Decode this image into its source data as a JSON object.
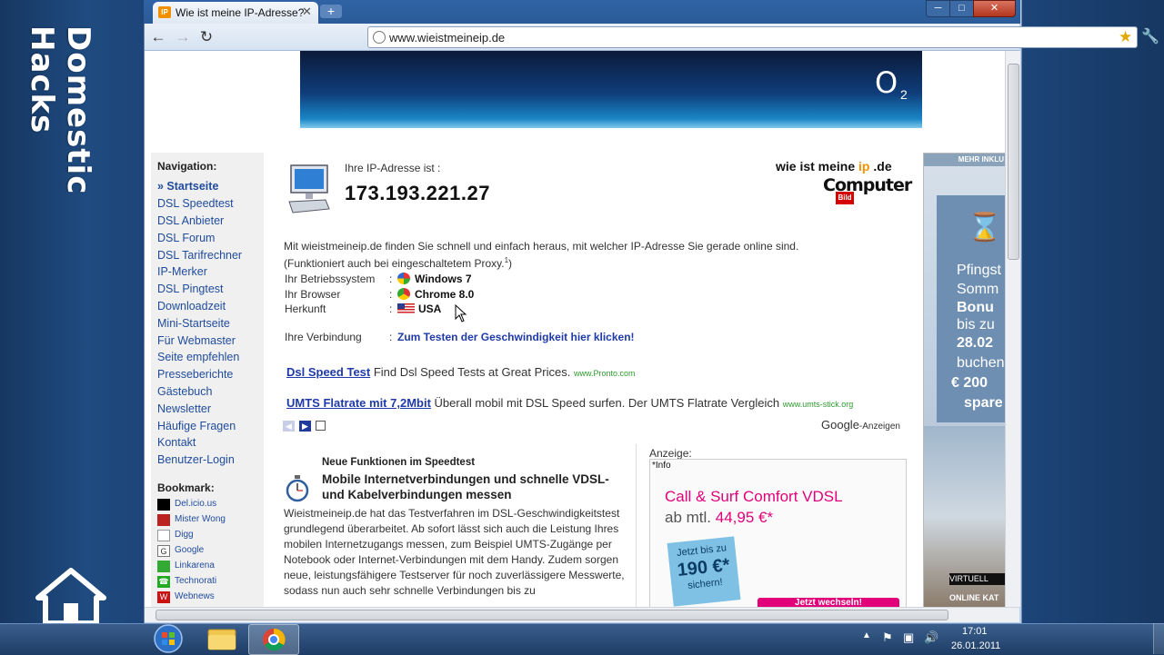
{
  "branding": {
    "channel_name": "Domestic Hacks"
  },
  "browser": {
    "tab_title": "Wie ist meine IP-Adresse?",
    "tab_favicon": "IP",
    "url": "www.wieistmeineip.de",
    "window_buttons": {
      "minimize": "─",
      "maximize": "□",
      "close": "✕"
    }
  },
  "banner": {
    "brand": "O",
    "brand_sub": "2"
  },
  "nav": {
    "title": "Navigation:",
    "items": [
      "» Startseite",
      "DSL Speedtest",
      "DSL Anbieter",
      "DSL Forum",
      "DSL Tarifrechner",
      "IP-Merker",
      "DSL Pingtest",
      "Downloadzeit",
      "Mini-Startseite",
      "Für Webmaster",
      "Seite empfehlen",
      "Presseberichte",
      "Gästebuch",
      "Newsletter",
      "Häufige Fragen",
      "Kontakt",
      "Benutzer-Login"
    ]
  },
  "bookmarks": {
    "title": "Bookmark:",
    "items": [
      "Del.icio.us",
      "Mister Wong",
      "Digg",
      "Google",
      "Linkarena",
      "Technorati",
      "Webnews"
    ]
  },
  "ip": {
    "label": "Ihre IP-Adresse ist :",
    "value": "173.193.221.27"
  },
  "logo": {
    "part1": "wie ist meine ",
    "part2": "ip",
    "part3": " .de",
    "computer": "Computer",
    "bild": "Bild"
  },
  "intro": {
    "line1": "Mit wieistmeineip.de finden Sie schnell und einfach heraus, mit welcher IP-Adresse Sie gerade online sind.",
    "line2": "(Funktioniert auch bei eingeschaltetem Proxy.",
    "sup": "1",
    "line2_end": ")"
  },
  "info": {
    "os_label": "Ihr Betriebssystem",
    "os_value": "Windows 7",
    "browser_label": "Ihr Browser",
    "browser_value": "Chrome 8.0",
    "origin_label": "Herkunft",
    "origin_value": "USA",
    "connection_label": "Ihre Verbindung",
    "connection_link": "Zum Testen der Geschwindigkeit hier klicken!",
    "colon": ":"
  },
  "ads": [
    {
      "title": "Dsl Speed Test",
      "text": " Find Dsl Speed Tests at Great Prices. ",
      "url": "www.Pronto.com"
    },
    {
      "title": "UMTS Flatrate mit 7,2Mbit",
      "text": " Überall mobil mit DSL Speed surfen. Der UMTS Flatrate Vergleich ",
      "url": "www.umts-stick.org"
    }
  ],
  "google_ads": {
    "brand": "Google",
    "label": "-Anzeigen"
  },
  "news": {
    "head": "Neue Funktionen im Speedtest",
    "title": "Mobile Internetverbindungen und schnelle VDSL- und Kabelverbindungen messen",
    "body": "Wieistmeineip.de hat das Testverfahren im DSL-Geschwindigkeitstest grundlegend überarbeitet. Ab sofort lässt sich auch die Leistung Ihres mobilen Internetzugangs messen, zum Beispiel UMTS-Zugänge per Notebook oder Internet-Verbindungen mit dem Handy. Zudem sorgen neue, leistungsfähigere Testserver für noch zuverlässigere Messwerte, sodass nun auch sehr schnelle Verbindungen bis zu"
  },
  "anzeige": {
    "label": "Anzeige:",
    "info": "*Info",
    "title": "Call & Surf Comfort VDSL",
    "price_prefix": "ab mtl. ",
    "price": "44,95 €*",
    "sticker_line1": "Jetzt bis zu",
    "sticker_price": "190 €*",
    "sticker_line2": "sichern!",
    "button": "Jetzt wechseln!"
  },
  "skyscraper": {
    "top": "MEHR INKLU",
    "lines": [
      "Pfingst",
      "Somm",
      "Bonu",
      "bis zu",
      "28.02",
      "buchen",
      "€ 200",
      "spare"
    ],
    "virtual": "VIRTUELL",
    "online": "ONLINE KAT"
  },
  "taskbar": {
    "time": "17:01",
    "date": "26.01.2011"
  },
  "colors": {
    "link": "#1f4b9b",
    "telekom": "#e2007a",
    "accent": "#f29000"
  }
}
